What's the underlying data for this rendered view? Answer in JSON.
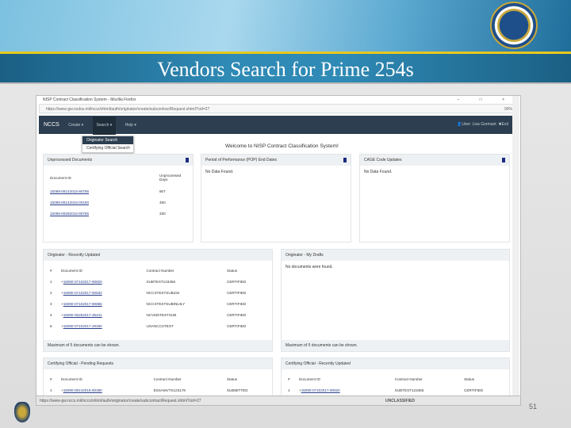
{
  "slide": {
    "title": "Vendors Search for Prime 254s",
    "page_number": "51"
  },
  "browser": {
    "window_title": "NISP Contract Classification System - Mozilla Firefox",
    "url": "https://www-gw.ncdss.mil/nccs/xhtml/auth/originator/create/subcontractRequest.xhtml?cid=27",
    "status_url": "https://www-gw.nccs.mil/nccs/xhtml/auth/originator/create/subcontractRequest.xhtml?cid=27",
    "zoom": "90%",
    "controls": "– □ ×"
  },
  "nav": {
    "brand": "NCCS",
    "items": [
      "Create ▾",
      "Search ▾",
      "Help ▾"
    ],
    "user": "User: Lisa Gormant",
    "exit": "Exit"
  },
  "search_menu": [
    "Originator Search",
    "Certifying Official Search"
  ],
  "welcome": "Welcome to NISP Contract Classification System!",
  "unprocessed": {
    "title": "Unprocessed Documents",
    "headers": [
      "Document ID",
      "Unprocessed Days"
    ],
    "rows": [
      [
        "15099-09142015-90796",
        "907"
      ],
      [
        "15099-08142016-00180",
        "450"
      ],
      [
        "15099-09282016-90765",
        "330"
      ]
    ]
  },
  "pop": {
    "title": "Period of Performance (POP) End Dates",
    "empty": "No Data Found."
  },
  "cage": {
    "title": "CAGE Code Updates",
    "empty": "No Data Found."
  },
  "recent": {
    "title": "Originator - Recently Updated",
    "headers": [
      "#",
      "Document ID",
      "Contract Number",
      "Status"
    ],
    "rows": [
      [
        "1",
        "15090-07102017-90820",
        "SUBTEST123456",
        "CERTIFIED"
      ],
      [
        "2",
        "15090-07102017-90832",
        "NCCSTESTSUB234",
        "CERTIFIED"
      ],
      [
        "3",
        "15090-07102017-90855",
        "NCCSTESTSUBINUILY",
        "CERTIFIED"
      ],
      [
        "4",
        "15090-06262017-36441",
        "NCVMSTESTSUB",
        "CERTIFIED"
      ],
      [
        "5",
        "15090-07102017-29460",
        "USANCCSTEST",
        "CERTIFIED"
      ]
    ],
    "footer": "Maximum of 5 documents can be shown."
  },
  "drafts": {
    "title": "Originator - My Drafts",
    "empty": "No documents were found.",
    "footer": "Maximum of 5 documents can be shown."
  },
  "pending": {
    "title": "Certifying Official - Pending Requests",
    "headers": [
      "#",
      "Document ID",
      "Contract Number",
      "Status"
    ],
    "rows": [
      [
        "1",
        "15090-08142016-80380",
        "ESSAMVTS123178",
        "SUBMITTED"
      ]
    ]
  },
  "co_recent": {
    "title": "Certifying Official - Recently Updated",
    "headers": [
      "#",
      "Document ID",
      "Contract Number",
      "Status"
    ],
    "rows": [
      [
        "1",
        "15090-07102017-90820",
        "SUBTEST123456",
        "CERTIFIED"
      ]
    ]
  },
  "classification": "UNCLASSIFIED"
}
